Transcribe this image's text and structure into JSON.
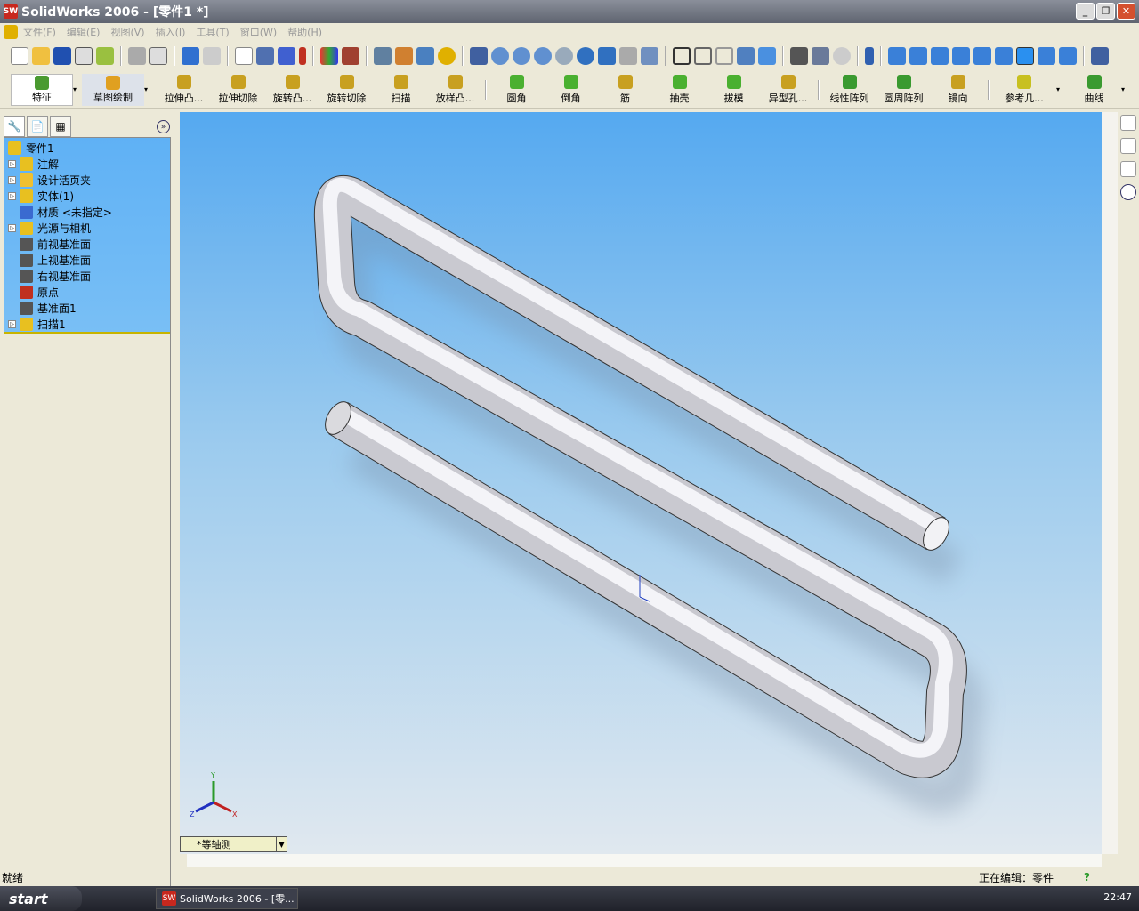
{
  "window": {
    "title": "SolidWorks 2006 - [零件1 *]",
    "logo": "SW"
  },
  "menu": [
    "文件(F)",
    "编辑(E)",
    "视图(V)",
    "插入(I)",
    "工具(T)",
    "窗口(W)",
    "帮助(H)"
  ],
  "command_manager": {
    "tabs": [
      "特征",
      "草图绘制"
    ],
    "commands": [
      "拉伸凸...",
      "拉伸切除",
      "旋转凸...",
      "旋转切除",
      "扫描",
      "放样凸...",
      "圆角",
      "倒角",
      "筋",
      "抽壳",
      "拔模",
      "异型孔...",
      "线性阵列",
      "圆周阵列",
      "镜向",
      "参考几...",
      "曲线"
    ]
  },
  "feature_tree": {
    "root": "零件1",
    "items": [
      {
        "label": "注解",
        "expandable": true,
        "color": "#e8c020"
      },
      {
        "label": "设计活页夹",
        "expandable": true,
        "color": "#f0c030"
      },
      {
        "label": "实体(1)",
        "expandable": true,
        "color": "#e8c020"
      },
      {
        "label": "材质 <未指定>",
        "expandable": false,
        "color": "#3a6ad0"
      },
      {
        "label": "光源与相机",
        "expandable": true,
        "color": "#e8c020"
      },
      {
        "label": "前视基准面",
        "expandable": false,
        "color": "#555555"
      },
      {
        "label": "上视基准面",
        "expandable": false,
        "color": "#555555"
      },
      {
        "label": "右视基准面",
        "expandable": false,
        "color": "#555555"
      },
      {
        "label": "原点",
        "expandable": false,
        "color": "#c03020"
      },
      {
        "label": "基准面1",
        "expandable": false,
        "color": "#555555"
      },
      {
        "label": "扫描1",
        "expandable": true,
        "color": "#e8c020"
      }
    ]
  },
  "viewport": {
    "view_orientation": "*等轴测",
    "triad": {
      "x": "X",
      "y": "Y",
      "z": "Z"
    }
  },
  "status": {
    "left": "就绪",
    "editing": "正在编辑：零件",
    "help": "?"
  },
  "taskbar": {
    "start": "start",
    "task": "SolidWorks 2006 - [零...",
    "clock": "22:47"
  }
}
